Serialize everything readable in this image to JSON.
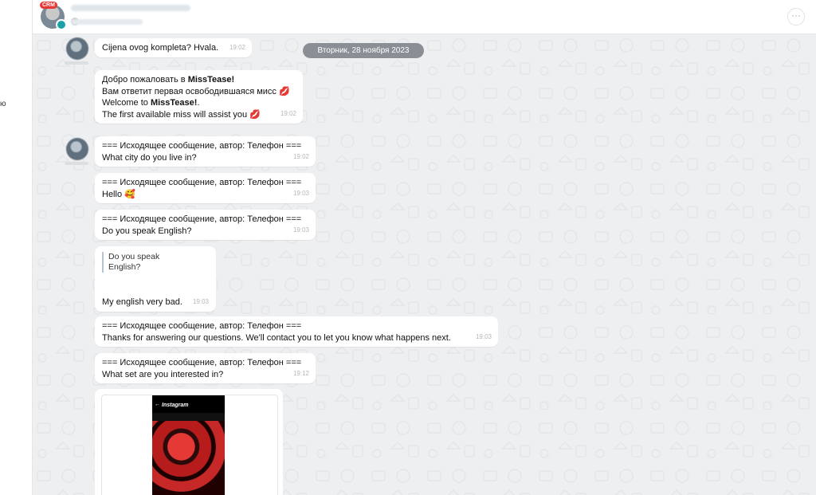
{
  "header": {
    "crm_badge": "CRM",
    "more_icon": "more-horizontal-icon"
  },
  "left_panel": {
    "fragment": "ю"
  },
  "chat": {
    "date_divider": "Вторник, 28 ноября 2023",
    "messages": [
      {
        "text": "Cijena ovog kompleta? Hvala.",
        "time": "19:02"
      },
      {
        "line1": "Добро пожаловать в ",
        "line1_bold": "MissTease!",
        "line2": "Вам ответит первая освободившаяся мисс ",
        "line3": "Welcome to ",
        "line3_bold": "MissTease!",
        "line3_end": ".",
        "line4": "The first available miss will assist you ",
        "emoji": "💋",
        "time": "19:02"
      },
      {
        "text": "=== Исходящее сообщение, автор: Телефон ===\nWhat city do you live in?",
        "time": "19:02"
      },
      {
        "text": "=== Исходящее сообщение, автор: Телефон ===\nHello ",
        "emoji": "🥰",
        "time": "19:03"
      },
      {
        "text": "=== Исходящее сообщение, автор: Телефон ===\nDo you speak English?",
        "time": "19:03"
      },
      {
        "quote": "Do you speak\nEnglish?",
        "text": "My english very bad.",
        "time": "19:03"
      },
      {
        "text": "=== Исходящее сообщение, автор: Телефон ===\nThanks for answering our questions. We'll contact you to let you know what happens next.",
        "time": "19:03"
      },
      {
        "text": "=== Исходящее сообщение, автор: Телефон ===\nWhat set are you interested in?",
        "time": "19:12"
      }
    ],
    "image_card": {
      "app_title": "Instagram",
      "back_icon": "back-arrow-icon"
    }
  }
}
